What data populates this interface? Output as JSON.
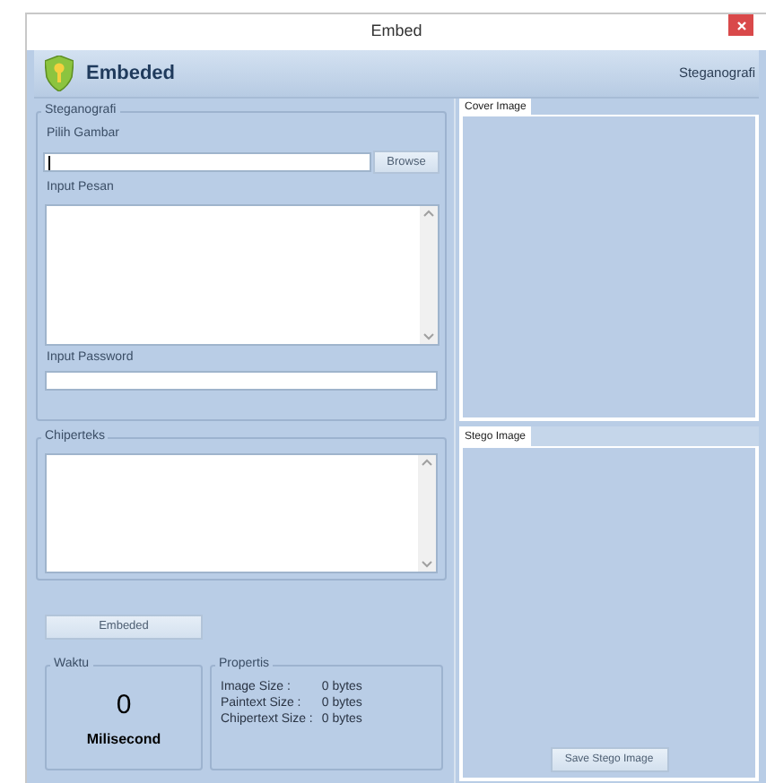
{
  "window": {
    "title": "Embed"
  },
  "header": {
    "title": "Embeded",
    "subtitle": "Steganografi"
  },
  "steganografi": {
    "title": "Steganografi",
    "file_label": "Pilih Gambar",
    "file_focused": true,
    "browse": "Browse",
    "message_label": "Input Pesan",
    "password_label": "Input Password"
  },
  "chiperteks": {
    "title": "Chiperteks"
  },
  "embed_button": "Embeded",
  "waktu": {
    "title": "Waktu",
    "value": "0",
    "unit": "Milisecond"
  },
  "propertis": {
    "title": "Propertis",
    "rows": [
      {
        "label": "Image Size :",
        "value": "0 bytes"
      },
      {
        "label": "Paintext Size :",
        "value": "0 bytes"
      },
      {
        "label": "Chipertext Size :",
        "value": "0 bytes"
      }
    ]
  },
  "cover": {
    "tab": "Cover Image"
  },
  "stego": {
    "tab": "Stego Image",
    "save": "Save Stego Image"
  }
}
